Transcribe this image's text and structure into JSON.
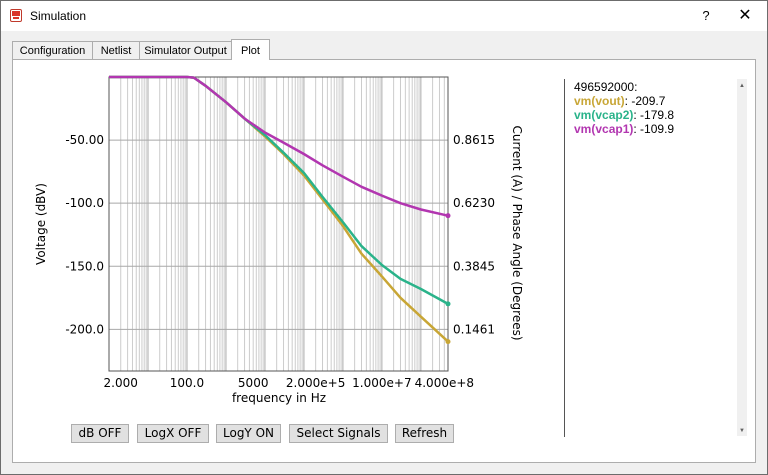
{
  "window": {
    "title": "Simulation",
    "help_label": "?",
    "close_label": "✕"
  },
  "tabs": [
    {
      "label": "Configuration"
    },
    {
      "label": "Netlist"
    },
    {
      "label": "Simulator Output"
    },
    {
      "label": "Plot",
      "active": true
    }
  ],
  "readout": {
    "x_value": "496592000:",
    "signals": [
      {
        "name": "vm(vout)",
        "value": "-209.7",
        "color": "#c8a636"
      },
      {
        "name": "vm(vcap2)",
        "value": "-179.8",
        "color": "#2ab38a"
      },
      {
        "name": "vm(vcap1)",
        "value": "-109.9",
        "color": "#b236b0"
      }
    ]
  },
  "buttons": {
    "db": "dB OFF",
    "logx": "LogX OFF",
    "logy": "LogY ON",
    "select": "Select Signals",
    "refresh": "Refresh"
  },
  "chart_data": {
    "type": "line",
    "xlabel": "frequency in Hz",
    "ylabel": "Voltage (dBV)",
    "y2label": "Current (A) / Phase Angle (Degrees)",
    "x_scale": "log",
    "x_range": [
      1,
      496592000
    ],
    "xtick_labels": [
      {
        "label": "2.000",
        "x": 2
      },
      {
        "label": "100.0",
        "x": 100
      },
      {
        "label": "5000",
        "x": 5000
      },
      {
        "label": "2.000e+5",
        "x": 200000
      },
      {
        "label": "1.000e+7",
        "x": 10000000
      },
      {
        "label": "4.000e+8",
        "x": 400000000
      }
    ],
    "ylim": [
      -233,
      0
    ],
    "yticks": [
      -50,
      -100,
      -150,
      -200
    ],
    "ytick_labels": [
      "-50.00",
      "-100.0",
      "-150.0",
      "-200.0"
    ],
    "y2tick_labels": [
      "0.8615",
      "0.6230",
      "0.3845",
      "0.1461"
    ],
    "grid": true,
    "series": [
      {
        "name": "vm(vout)",
        "color": "#c8a636",
        "points": [
          [
            1,
            0
          ],
          [
            100,
            0
          ],
          [
            150,
            -0.5
          ],
          [
            300,
            -7
          ],
          [
            1000,
            -20
          ],
          [
            3000,
            -33
          ],
          [
            10000,
            -47
          ],
          [
            30000,
            -61
          ],
          [
            100000,
            -78
          ],
          [
            300000,
            -97
          ],
          [
            1000000,
            -118
          ],
          [
            3000000,
            -140
          ],
          [
            10000000,
            -158
          ],
          [
            30000000,
            -175
          ],
          [
            100000000,
            -190
          ],
          [
            496592000,
            -209.7
          ]
        ]
      },
      {
        "name": "vm(vcap2)",
        "color": "#2ab38a",
        "points": [
          [
            1,
            0
          ],
          [
            100,
            0
          ],
          [
            150,
            -0.5
          ],
          [
            300,
            -7
          ],
          [
            1000,
            -20
          ],
          [
            3000,
            -33
          ],
          [
            10000,
            -46
          ],
          [
            30000,
            -60
          ],
          [
            100000,
            -76
          ],
          [
            300000,
            -95
          ],
          [
            1000000,
            -115
          ],
          [
            3000000,
            -134
          ],
          [
            10000000,
            -149
          ],
          [
            30000000,
            -160
          ],
          [
            100000000,
            -168
          ],
          [
            496592000,
            -179.8
          ]
        ]
      },
      {
        "name": "vm(vcap1)",
        "color": "#b236b0",
        "points": [
          [
            1,
            0
          ],
          [
            100,
            0
          ],
          [
            150,
            -0.5
          ],
          [
            300,
            -7
          ],
          [
            1000,
            -20
          ],
          [
            3000,
            -33
          ],
          [
            10000,
            -44
          ],
          [
            30000,
            -52
          ],
          [
            100000,
            -61
          ],
          [
            300000,
            -70
          ],
          [
            1000000,
            -79
          ],
          [
            3000000,
            -87
          ],
          [
            10000000,
            -94
          ],
          [
            30000000,
            -100
          ],
          [
            100000000,
            -105
          ],
          [
            496592000,
            -109.9
          ]
        ]
      }
    ]
  }
}
